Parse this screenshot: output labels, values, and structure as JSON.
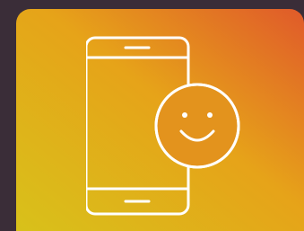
{
  "tile": {
    "gradient": {
      "start": "#d8c11a",
      "mid": "#e6a319",
      "end": "#e05a2a"
    }
  },
  "icon": {
    "name": "smartphone-smiley-icon",
    "stroke": "#ffffff"
  },
  "background_color": "#3a2d38"
}
